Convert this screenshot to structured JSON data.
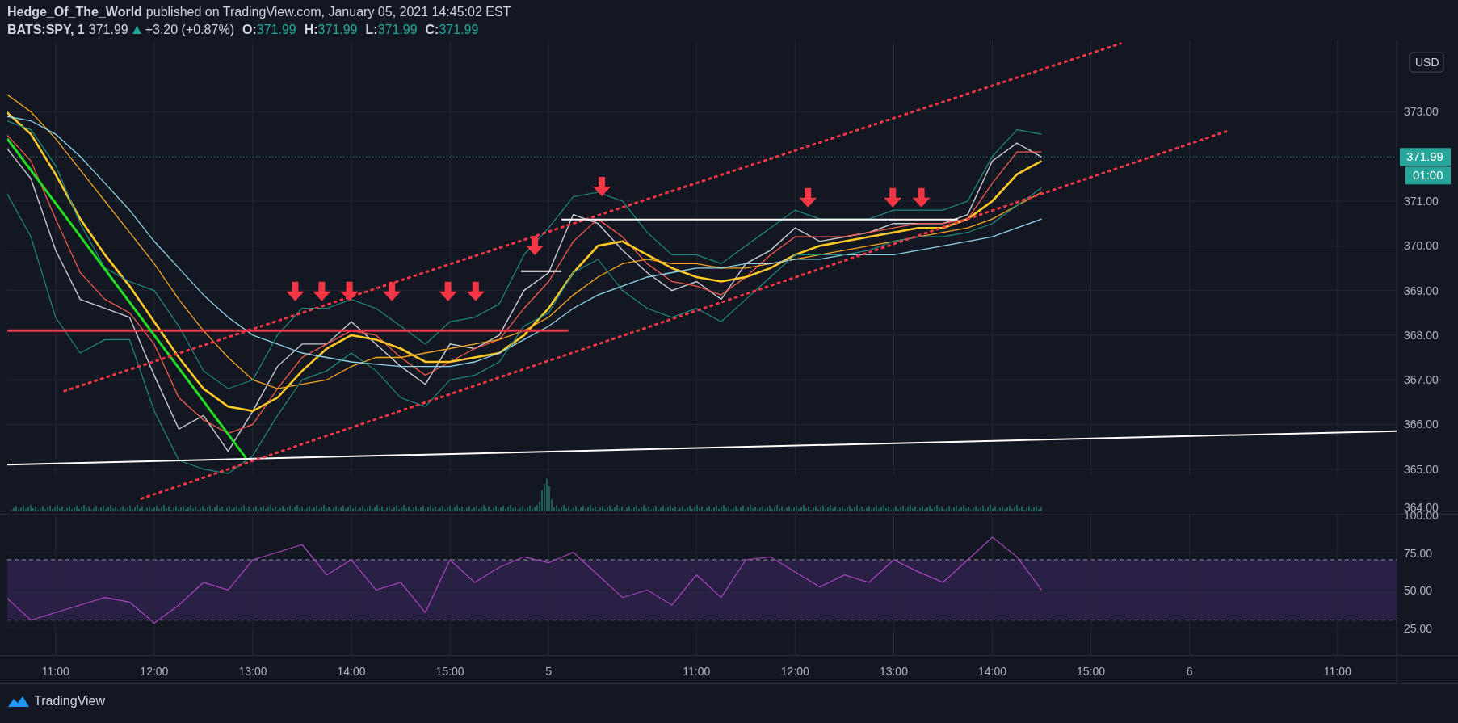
{
  "header": {
    "author": "Hedge_Of_The_World",
    "published": "published on TradingView.com, January 05, 2021 14:45:02 EST"
  },
  "quote": {
    "symbol": "BATS:SPY, 1",
    "last": "371.99",
    "change": "+3.20 (+0.87%)",
    "ohlc": [
      {
        "label": "O:",
        "value": "371.99"
      },
      {
        "label": "H:",
        "value": "371.99"
      },
      {
        "label": "L:",
        "value": "371.99"
      },
      {
        "label": "C:",
        "value": "371.99"
      }
    ]
  },
  "price_pane": {
    "currency": "USD",
    "last_price": "371.99",
    "countdown": "01:00",
    "chart_data": {
      "type": "line",
      "grid": true,
      "ylim": [
        364,
        374.6
      ],
      "yticks": [
        {
          "value": 364,
          "label": "364.00"
        },
        {
          "value": 365,
          "label": "365.00"
        },
        {
          "value": 366,
          "label": "366.00"
        },
        {
          "value": 367,
          "label": "367.00"
        },
        {
          "value": 368,
          "label": "368.00"
        },
        {
          "value": 369,
          "label": "369.00"
        },
        {
          "value": 370,
          "label": "370.00"
        },
        {
          "value": 371,
          "label": "371.00"
        },
        {
          "value": 373,
          "label": "373.00"
        }
      ],
      "series": [
        {
          "color": "#c9cbd1",
          "values": [
            372.2,
            371.5,
            369.9,
            368.8,
            368.6,
            368.4,
            367.1,
            365.9,
            366.2,
            365.4,
            366.3,
            367.3,
            367.8,
            367.8,
            368.3,
            367.8,
            367.3,
            366.9,
            367.8,
            367.7,
            368.0,
            369.0,
            369.4,
            370.7,
            370.5,
            369.9,
            369.4,
            369.0,
            369.2,
            368.8,
            369.6,
            369.9,
            370.4,
            370.1,
            370.2,
            370.3,
            370.5,
            370.5,
            370.5,
            370.7,
            371.9,
            372.3,
            371.99,
            null,
            null,
            null,
            null,
            null,
            null,
            null,
            null,
            null,
            null,
            null,
            null,
            null,
            null
          ]
        },
        {
          "color": "#f55a4e",
          "values": [
            372.5,
            371.9,
            370.6,
            369.4,
            368.8,
            368.5,
            367.8,
            366.6,
            366.1,
            365.8,
            366.0,
            366.8,
            367.5,
            367.8,
            368.1,
            368.0,
            367.5,
            367.1,
            367.4,
            367.7,
            367.9,
            368.6,
            369.2,
            370.1,
            370.6,
            370.2,
            369.6,
            369.2,
            369.1,
            368.9,
            369.3,
            369.8,
            370.2,
            370.2,
            370.2,
            370.3,
            370.4,
            370.5,
            370.5,
            370.6,
            371.4,
            372.1,
            372.1,
            null,
            null,
            null,
            null,
            null,
            null,
            null,
            null,
            null,
            null,
            null,
            null,
            null,
            null
          ]
        },
        {
          "color": "#ffca28",
          "values": [
            373.0,
            372.5,
            371.6,
            370.6,
            369.8,
            369.1,
            368.3,
            367.5,
            366.8,
            366.4,
            366.3,
            366.6,
            367.2,
            367.7,
            368.0,
            367.9,
            367.7,
            367.4,
            367.4,
            367.5,
            367.6,
            368.0,
            368.6,
            369.4,
            370.0,
            370.1,
            369.8,
            369.5,
            369.3,
            369.2,
            369.3,
            369.5,
            369.8,
            370.0,
            370.1,
            370.2,
            370.3,
            370.4,
            370.4,
            370.6,
            371.0,
            371.6,
            371.9,
            null,
            null,
            null,
            null,
            null,
            null,
            null,
            null,
            null,
            null,
            null,
            null,
            null,
            null
          ]
        },
        {
          "color": "#f5a623",
          "values": [
            373.4,
            373.0,
            372.4,
            371.7,
            371.0,
            370.3,
            369.6,
            368.8,
            368.1,
            367.5,
            367.0,
            366.8,
            366.9,
            367.0,
            367.3,
            367.5,
            367.5,
            367.6,
            367.7,
            367.8,
            367.9,
            368.1,
            368.4,
            368.9,
            369.3,
            369.6,
            369.7,
            369.6,
            369.6,
            369.5,
            369.5,
            369.6,
            369.7,
            369.8,
            369.9,
            370.0,
            370.1,
            370.2,
            370.3,
            370.4,
            370.6,
            370.9,
            371.2,
            null,
            null,
            null,
            null,
            null,
            null,
            null,
            null,
            null,
            null,
            null,
            null,
            null,
            null
          ]
        },
        {
          "color": "#8fd3e8",
          "values": [
            372.9,
            372.8,
            372.5,
            372.0,
            371.4,
            370.8,
            370.1,
            369.5,
            368.9,
            368.4,
            368.0,
            367.8,
            367.6,
            367.5,
            367.4,
            367.35,
            367.3,
            367.3,
            367.3,
            367.4,
            367.6,
            367.9,
            368.2,
            368.6,
            368.9,
            369.1,
            369.3,
            369.4,
            369.5,
            369.5,
            369.6,
            369.6,
            369.7,
            369.7,
            369.8,
            369.8,
            369.8,
            369.9,
            370.0,
            370.1,
            370.2,
            370.4,
            370.6,
            null,
            null,
            null,
            null,
            null,
            null,
            null,
            null,
            null,
            null,
            null,
            null,
            null,
            null
          ]
        },
        {
          "color": "#1e8c80",
          "values": [
            372.8,
            372.6,
            371.8,
            370.5,
            369.5,
            369.2,
            369.0,
            368.2,
            367.2,
            366.8,
            367.0,
            368.0,
            368.6,
            368.6,
            368.8,
            368.6,
            368.2,
            367.8,
            368.3,
            368.4,
            368.7,
            369.8,
            370.4,
            371.1,
            371.2,
            371.0,
            370.3,
            369.8,
            369.8,
            369.6,
            370.0,
            370.4,
            370.8,
            370.6,
            370.6,
            370.6,
            370.8,
            370.8,
            370.8,
            371.0,
            372.0,
            372.6,
            372.5,
            null,
            null,
            null,
            null,
            null,
            null,
            null,
            null,
            null,
            null,
            null,
            null,
            null,
            null
          ]
        },
        {
          "color": "#1e8c80",
          "values": [
            371.2,
            370.2,
            368.4,
            367.6,
            367.9,
            367.9,
            366.3,
            365.2,
            365.0,
            364.9,
            365.3,
            366.2,
            367.0,
            367.2,
            367.6,
            367.2,
            366.6,
            366.4,
            367.0,
            367.1,
            367.4,
            368.2,
            368.5,
            369.4,
            369.7,
            369.0,
            368.6,
            368.4,
            368.6,
            368.3,
            368.8,
            369.3,
            369.8,
            369.8,
            369.8,
            369.9,
            370.1,
            370.2,
            370.2,
            370.3,
            370.5,
            370.9,
            371.3,
            null,
            null,
            null,
            null,
            null,
            null,
            null,
            null,
            null,
            null,
            null,
            null,
            null,
            null
          ]
        }
      ]
    }
  },
  "rsi_pane": {
    "chart_data": {
      "type": "line",
      "grid": true,
      "ylim": [
        6.25,
        100
      ],
      "yticks": [
        {
          "value": 25,
          "label": "25.00"
        },
        {
          "value": 50,
          "label": "50.00"
        },
        {
          "value": 75,
          "label": "75.00"
        },
        {
          "value": 100,
          "label": "100.00"
        }
      ],
      "categories": [
        null,
        null,
        "11:00",
        null,
        null,
        null,
        "12:00",
        null,
        null,
        null,
        "13:00",
        null,
        null,
        null,
        "14:00",
        null,
        null,
        null,
        "15:00",
        null,
        null,
        null,
        "5",
        null,
        null,
        null,
        null,
        null,
        "11:00",
        null,
        null,
        null,
        "12:00",
        null,
        null,
        null,
        "13:00",
        null,
        null,
        null,
        "14:00",
        null,
        null,
        null,
        "15:00",
        null,
        null,
        null,
        "6",
        null,
        null,
        null,
        null,
        null,
        "11:00",
        null,
        null
      ],
      "series": [
        {
          "color": "#ab47bc",
          "values": [
            45,
            30,
            35,
            40,
            45,
            42,
            28,
            40,
            55,
            50,
            70,
            75,
            80,
            60,
            70,
            50,
            55,
            35,
            70,
            55,
            65,
            72,
            68,
            75,
            60,
            45,
            50,
            40,
            60,
            45,
            70,
            72,
            62,
            52,
            60,
            55,
            70,
            62,
            55,
            70,
            85,
            72,
            50,
            null,
            null,
            null,
            null,
            null,
            null,
            null,
            null,
            null,
            null,
            null,
            null,
            null,
            null
          ]
        }
      ]
    }
  },
  "footer": {
    "brand": "TradingView"
  }
}
